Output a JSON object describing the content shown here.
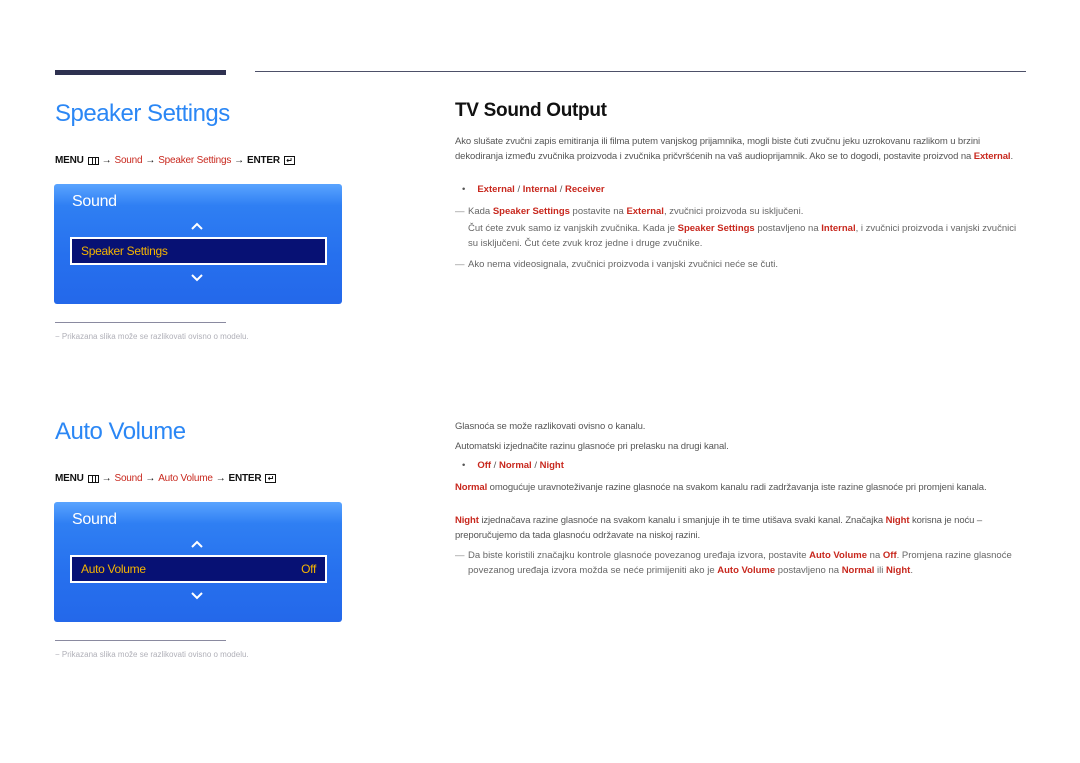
{
  "sections": {
    "speaker_settings": {
      "title": "Speaker Settings",
      "breadcrumb": {
        "menu": "MENU",
        "arrow": "→",
        "sound": "Sound",
        "item": "Speaker Settings",
        "enter": "ENTER",
        "enter_glyph": "↵"
      },
      "osd": {
        "title": "Sound",
        "selected_item": "Speaker Settings",
        "selected_value": ""
      },
      "footnote": "−  Prikazana slika može se razlikovati ovisno o modelu."
    },
    "auto_volume": {
      "title": "Auto Volume",
      "breadcrumb": {
        "menu": "MENU",
        "arrow": "→",
        "sound": "Sound",
        "item": "Auto Volume",
        "enter": "ENTER",
        "enter_glyph": "↵"
      },
      "osd": {
        "title": "Sound",
        "selected_item": "Auto Volume",
        "selected_value": "Off"
      },
      "footnote": "−  Prikazana slika može se razlikovati ovisno o modelu."
    }
  },
  "tv_sound_output": {
    "heading": "TV Sound Output",
    "intro_1": "Ako slušate zvučni zapis emitiranja ili filma putem vanjskog prijamnika, mogli biste čuti zvučnu jeku uzrokovanu razlikom u brzini dekodiranja između zvučnika proizvoda i zvučnika pričvršćenih na vaš audioprijamnik. Ako se to dogodi, postavite proizvod na ",
    "intro_hl": "External",
    "intro_end": ".",
    "options": [
      "External",
      "Internal",
      "Receiver"
    ],
    "separator": " / ",
    "bullet": "•",
    "note1": {
      "dash": "—",
      "t1": "Kada ",
      "h1": "Speaker Settings",
      "t2": " postavite na ",
      "h2": "External",
      "t3": ", zvučnici proizvoda su isključeni.",
      "line2_t1": "Čut ćete zvuk samo iz vanjskih zvučnika. Kada je ",
      "line2_h1": "Speaker Settings",
      "line2_t2": " postavljeno na ",
      "line2_h2": "Internal",
      "line2_t3": ", i zvučnici proizvoda i vanjski zvučnici su isključeni. Čut ćete zvuk kroz jedne i druge zvučnike."
    },
    "note2": {
      "dash": "—",
      "text": "Ako nema videosignala, zvučnici proizvoda i vanjski zvučnici neće se čuti."
    }
  },
  "auto_volume_text": {
    "p1": "Glasnoća se može razlikovati ovisno o kanalu.",
    "p2": "Automatski izjednačite razinu glasnoće pri prelasku na drugi kanal.",
    "options": [
      "Off",
      "Normal",
      "Night"
    ],
    "normal_label": "Normal",
    "normal_text": " omogućuje uravnoteživanje razine glasnoće na svakom kanalu radi zadržavanja iste razine glasnoće pri promjeni kanala.",
    "night_label": "Night",
    "night_text_1": " izjednačava razine glasnoće na svakom kanalu i smanjuje ih te time utišava svaki kanal. Značajka ",
    "night_label_2": "Night",
    "night_text_2": " korisna je noću – preporučujemo da tada glasnoću održavate na niskoj razini.",
    "note": {
      "dash": "—",
      "t1": "Da biste koristili značajku kontrole glasnoće povezanog uređaja izvora, postavite ",
      "h1": "Auto Volume",
      "t2": " na ",
      "h2": "Off",
      "t3": ". Promjena razine glasnoće povezanog uređaja izvora možda se neće primijeniti ako je ",
      "h3": "Auto Volume",
      "t4": " postavljeno na ",
      "h4": "Normal",
      "t5": " ili ",
      "h5": "Night",
      "t6": "."
    }
  },
  "colors": {
    "title_blue": "#2b87f5",
    "highlight_red": "#c8281e",
    "osd_blue": "#2670ee",
    "osd_selected_bg": "#071174",
    "osd_selected_text": "#f5b400"
  }
}
